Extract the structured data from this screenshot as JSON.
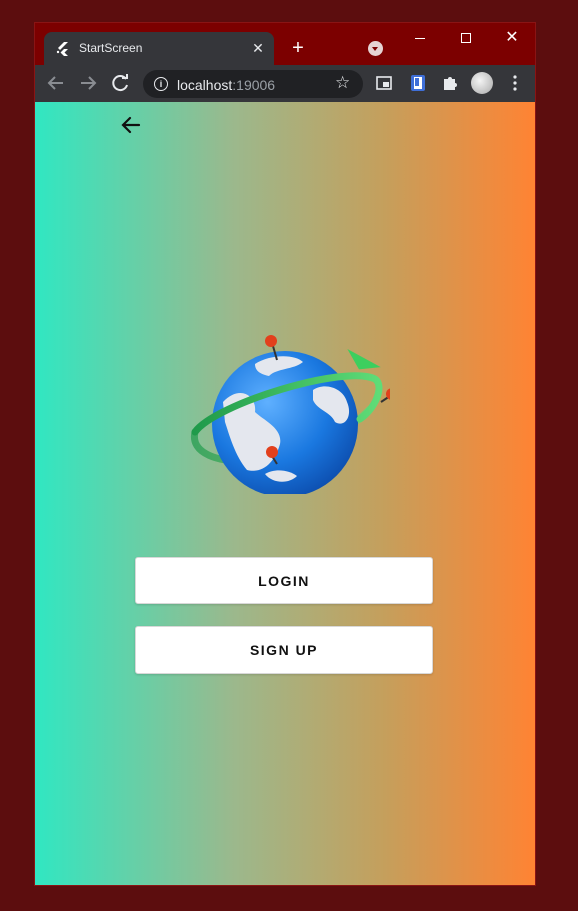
{
  "browser": {
    "tab_title": "StartScreen",
    "url_host": "localhost",
    "url_port": ":19006"
  },
  "icons": {
    "tab_favicon": "flutter-icon",
    "tab_close": "close-icon",
    "new_tab": "plus-icon",
    "tab_search": "chevron-down-icon",
    "minimize": "minimize-icon",
    "maximize": "maximize-icon",
    "close_window": "close-icon",
    "back": "arrow-left-icon",
    "forward": "arrow-right-icon",
    "reload": "reload-icon",
    "site_info": "info-icon",
    "bookmark": "star-icon",
    "picture_in_picture": "pip-icon",
    "reading_list": "reading-list-icon",
    "extensions": "puzzle-icon",
    "profile": "avatar",
    "menu": "kebab-menu-icon",
    "app_back": "arrow-left-icon",
    "hero": "globe-icon"
  },
  "app": {
    "login_label": "LOGIN",
    "signup_label": "SIGN UP"
  },
  "colors": {
    "window_frame": "#7c0000",
    "gradient_start": "#30e7c2",
    "gradient_end": "#ff8333",
    "button_bg": "#ffffff"
  }
}
